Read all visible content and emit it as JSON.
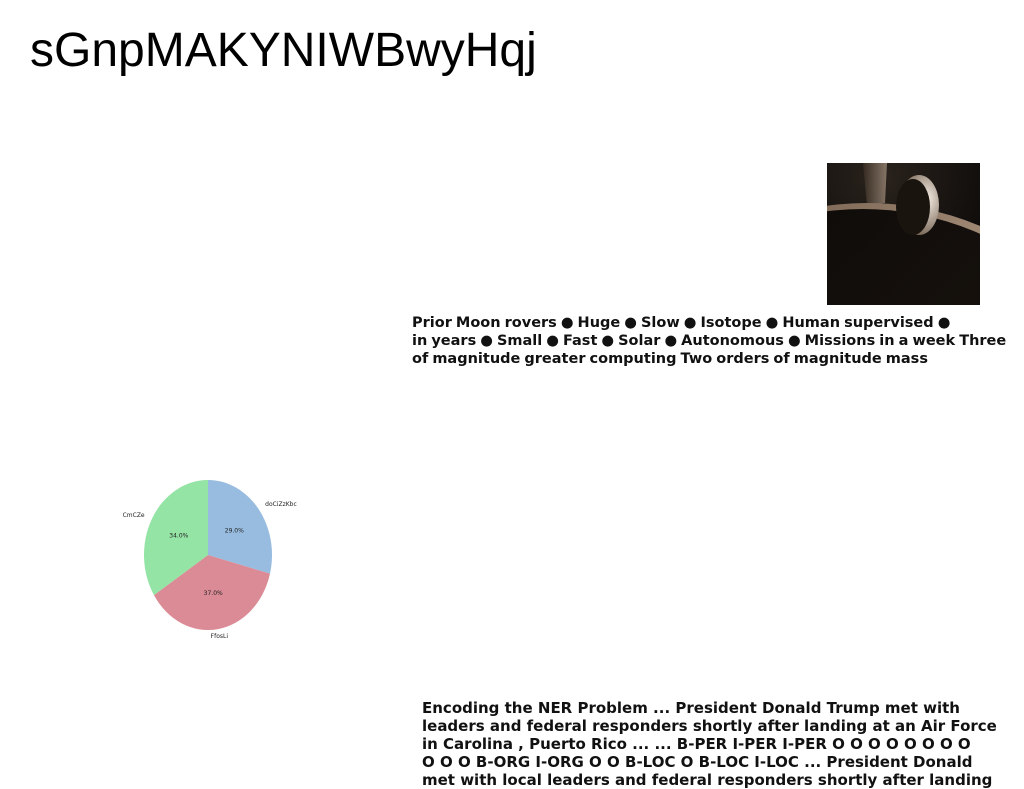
{
  "page_title": "sGnpMAKYNIWBwyHqj",
  "rover_comparison": {
    "lines": [
      "Prior Moon rovers ● Huge ● Slow ● Isotope ● Human supervised ●",
      "in years ● Small ● Fast ● Solar ● Autonomous ● Missions in a week Three",
      "of magnitude greater computing Two orders of magnitude mass"
    ]
  },
  "ner_excerpt": {
    "lines": [
      "Encoding the NER Problem ... President Donald Trump met with",
      "leaders and federal responders shortly after landing at an Air Force",
      "in Carolina , Puerto Rico ... ... B-PER I-PER I-PER O O O O O O O O",
      "O O O B-ORG I-ORG O O B-LOC O B-LOC I-LOC ... President Donald",
      "met with local leaders and federal responders shortly after landing"
    ]
  },
  "chart_data": {
    "type": "pie",
    "categories": [
      "doCiZzKbc",
      "FfosLi",
      "CmCZe"
    ],
    "values": [
      29.0,
      37.0,
      34.0
    ],
    "labels": [
      "29.0%",
      "37.0%",
      "34.0%"
    ],
    "colors": [
      "#98bcdf",
      "#da8b95",
      "#94e4a5"
    ],
    "title": ""
  }
}
